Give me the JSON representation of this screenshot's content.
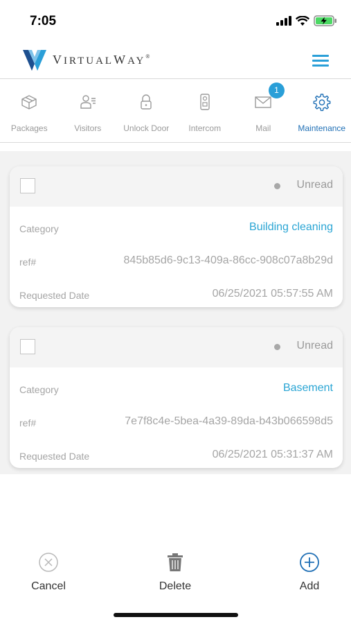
{
  "status_bar": {
    "time": "7:05",
    "icons": [
      "signal-icon",
      "wifi-icon",
      "battery-charging-icon"
    ]
  },
  "header": {
    "logo_text_first": "V",
    "logo_text_rest": "IRTUAL",
    "logo_text_first2": "W",
    "logo_text_rest2": "AY",
    "logo_mark": "®",
    "brand_color": "#2a9fd8"
  },
  "tabs": [
    {
      "label": "Packages",
      "icon": "package-icon"
    },
    {
      "label": "Visitors",
      "icon": "visitors-icon"
    },
    {
      "label": "Unlock Door",
      "icon": "lock-icon"
    },
    {
      "label": "Intercom",
      "icon": "intercom-icon"
    },
    {
      "label": "Mail",
      "icon": "mail-icon",
      "badge": "1"
    },
    {
      "label": "Maintenance",
      "icon": "gear-icon",
      "active": true
    }
  ],
  "requests": [
    {
      "status": "Unread",
      "category_label": "Category",
      "category": "Building cleaning",
      "ref_label": "ref#",
      "ref": "845b85d6-9c13-409a-86cc-908c07a8b29d",
      "date_label": "Requested Date",
      "date": "06/25/2021 05:57:55 AM"
    },
    {
      "status": "Unread",
      "category_label": "Category",
      "category": "Basement",
      "ref_label": "ref#",
      "ref": "7e7f8c4e-5bea-4a39-89da-b43b066598d5",
      "date_label": "Requested Date",
      "date": "06/25/2021 05:31:37 AM"
    }
  ],
  "toolbar": {
    "cancel_label": "Cancel",
    "delete_label": "Delete",
    "add_label": "Add"
  },
  "colors": {
    "accent": "#2aa5d4",
    "active_tab": "#1f6fb5"
  }
}
